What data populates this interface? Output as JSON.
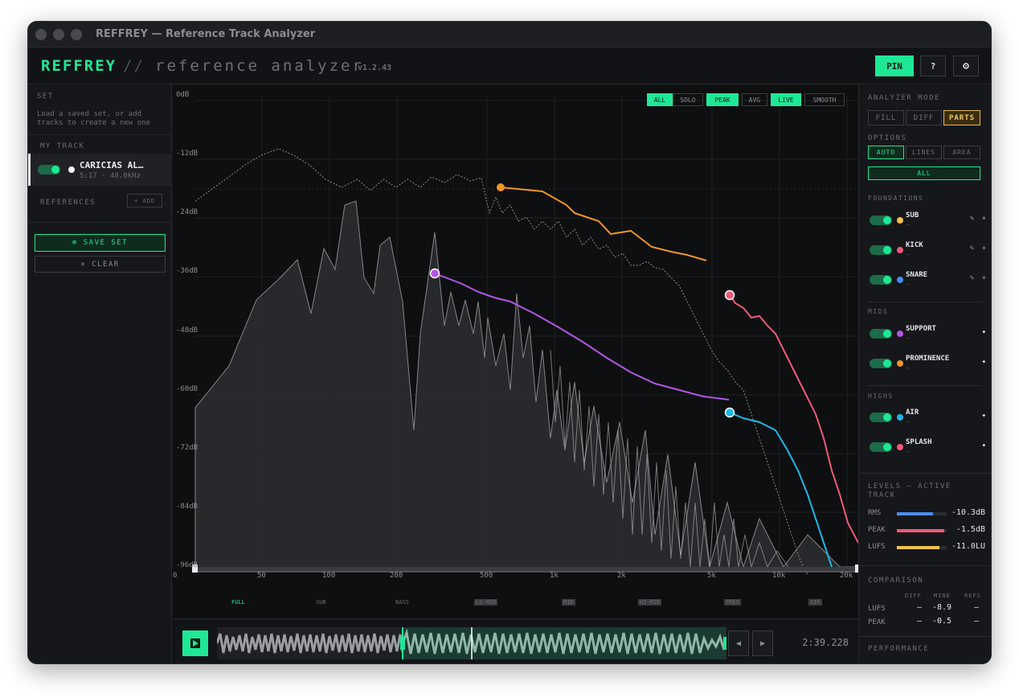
{
  "window": {
    "title": "REFFREY — Reference Track Analyzer"
  },
  "header": {
    "logo": "REFFREY",
    "logo_slash": "//",
    "subtitle": "reference analyzer",
    "version": "v1.2.43",
    "pin_label": "PIN",
    "help_label": "?",
    "settings_icon": "gear-icon"
  },
  "left": {
    "set_heading": "SET",
    "set_note": "Load a saved set, or add tracks to create a new one",
    "my_track_heading": "MY TRACK",
    "track": {
      "name": "CARICIAS AL…",
      "meta": "5:17 · 48.0kHz",
      "enabled": true
    },
    "references_heading": "REFERENCES",
    "add_label": "+ ADD",
    "save_label": "⊕ SAVE SET",
    "clear_label": "× CLEAR"
  },
  "graph": {
    "y_labels": [
      "0dB",
      "-12dB",
      "-24dB",
      "-36dB",
      "-48dB",
      "-60dB",
      "-72dB",
      "-84dB",
      "-96dB"
    ],
    "x_labels": [
      "0",
      "50",
      "100",
      "200",
      "500",
      "1k",
      "2k",
      "5k",
      "10k",
      "20k"
    ],
    "top_buttons": [
      {
        "label": "ALL",
        "active": true
      },
      {
        "label": "SOLO",
        "active": false
      },
      {
        "label": "PEAK",
        "active": true
      },
      {
        "label": "AVG",
        "active": false
      },
      {
        "label": "LIVE",
        "active": true
      },
      {
        "label": "SMOOTH",
        "active": false
      }
    ],
    "bands": [
      {
        "label": "FULL",
        "state": "active"
      },
      {
        "label": "SUB",
        "state": "normal"
      },
      {
        "label": "BASS",
        "state": "normal"
      },
      {
        "label": "LO-MID",
        "state": "dim"
      },
      {
        "label": "MID",
        "state": "dim"
      },
      {
        "label": "HI-MID",
        "state": "dim"
      },
      {
        "label": "PRES",
        "state": "dim"
      },
      {
        "label": "AIR",
        "state": "dim"
      }
    ]
  },
  "transport": {
    "timecode": "2:39.228",
    "prev_label": "◀",
    "next_label": "▶",
    "progress": 0.5
  },
  "right": {
    "mode_heading": "ANALYZER MODE",
    "modes": [
      "FILL",
      "DIFF",
      "PARTS"
    ],
    "active_mode": "PARTS",
    "options_heading": "OPTIONS",
    "options": [
      "AUTO",
      "LINES",
      "AREA"
    ],
    "active_option": "AUTO",
    "all_label": "ALL",
    "foundations_heading": "FOUNDATIONS",
    "foundations": [
      {
        "name": "SUB",
        "sub": "—",
        "color": "#f2c14e"
      },
      {
        "name": "KICK",
        "sub": "—",
        "color": "#ef5a78"
      },
      {
        "name": "SNARE",
        "sub": "—",
        "color": "#4a8cf0"
      }
    ],
    "mids_heading": "MIDS",
    "mids": [
      {
        "name": "SUPPORT",
        "sub": "—",
        "color": "#b356e6"
      },
      {
        "name": "PROMINENCE",
        "sub": "—",
        "color": "#f0952a"
      }
    ],
    "highs_heading": "HIGHS",
    "highs": [
      {
        "name": "AIR",
        "sub": "—",
        "color": "#1db8e6"
      },
      {
        "name": "SPLASH",
        "sub": "—",
        "color": "#ef5a78"
      }
    ],
    "levels_heading": "LEVELS — ACTIVE TRACK",
    "levels": [
      {
        "label": "RMS",
        "value": "-10.3dB",
        "fill": 0.72,
        "color": "#4a8cf0"
      },
      {
        "label": "PEAK",
        "value": "-1.5dB",
        "fill": 0.95,
        "color": "#ef5a78"
      },
      {
        "label": "LUFS",
        "value": "-11.0LU",
        "fill": 0.85,
        "color": "#f2c14e"
      }
    ],
    "comparison_heading": "COMPARISON",
    "comparison_cols": [
      "DIFF",
      "MINE",
      "REFS"
    ],
    "comparison_rows": [
      {
        "label": "LUFS",
        "diff": "—",
        "mine": "-8.9",
        "refs": "—"
      },
      {
        "label": "PEAK",
        "diff": "—",
        "mine": "-0.5",
        "refs": "—"
      }
    ],
    "performance_heading": "PERFORMANCE"
  }
}
